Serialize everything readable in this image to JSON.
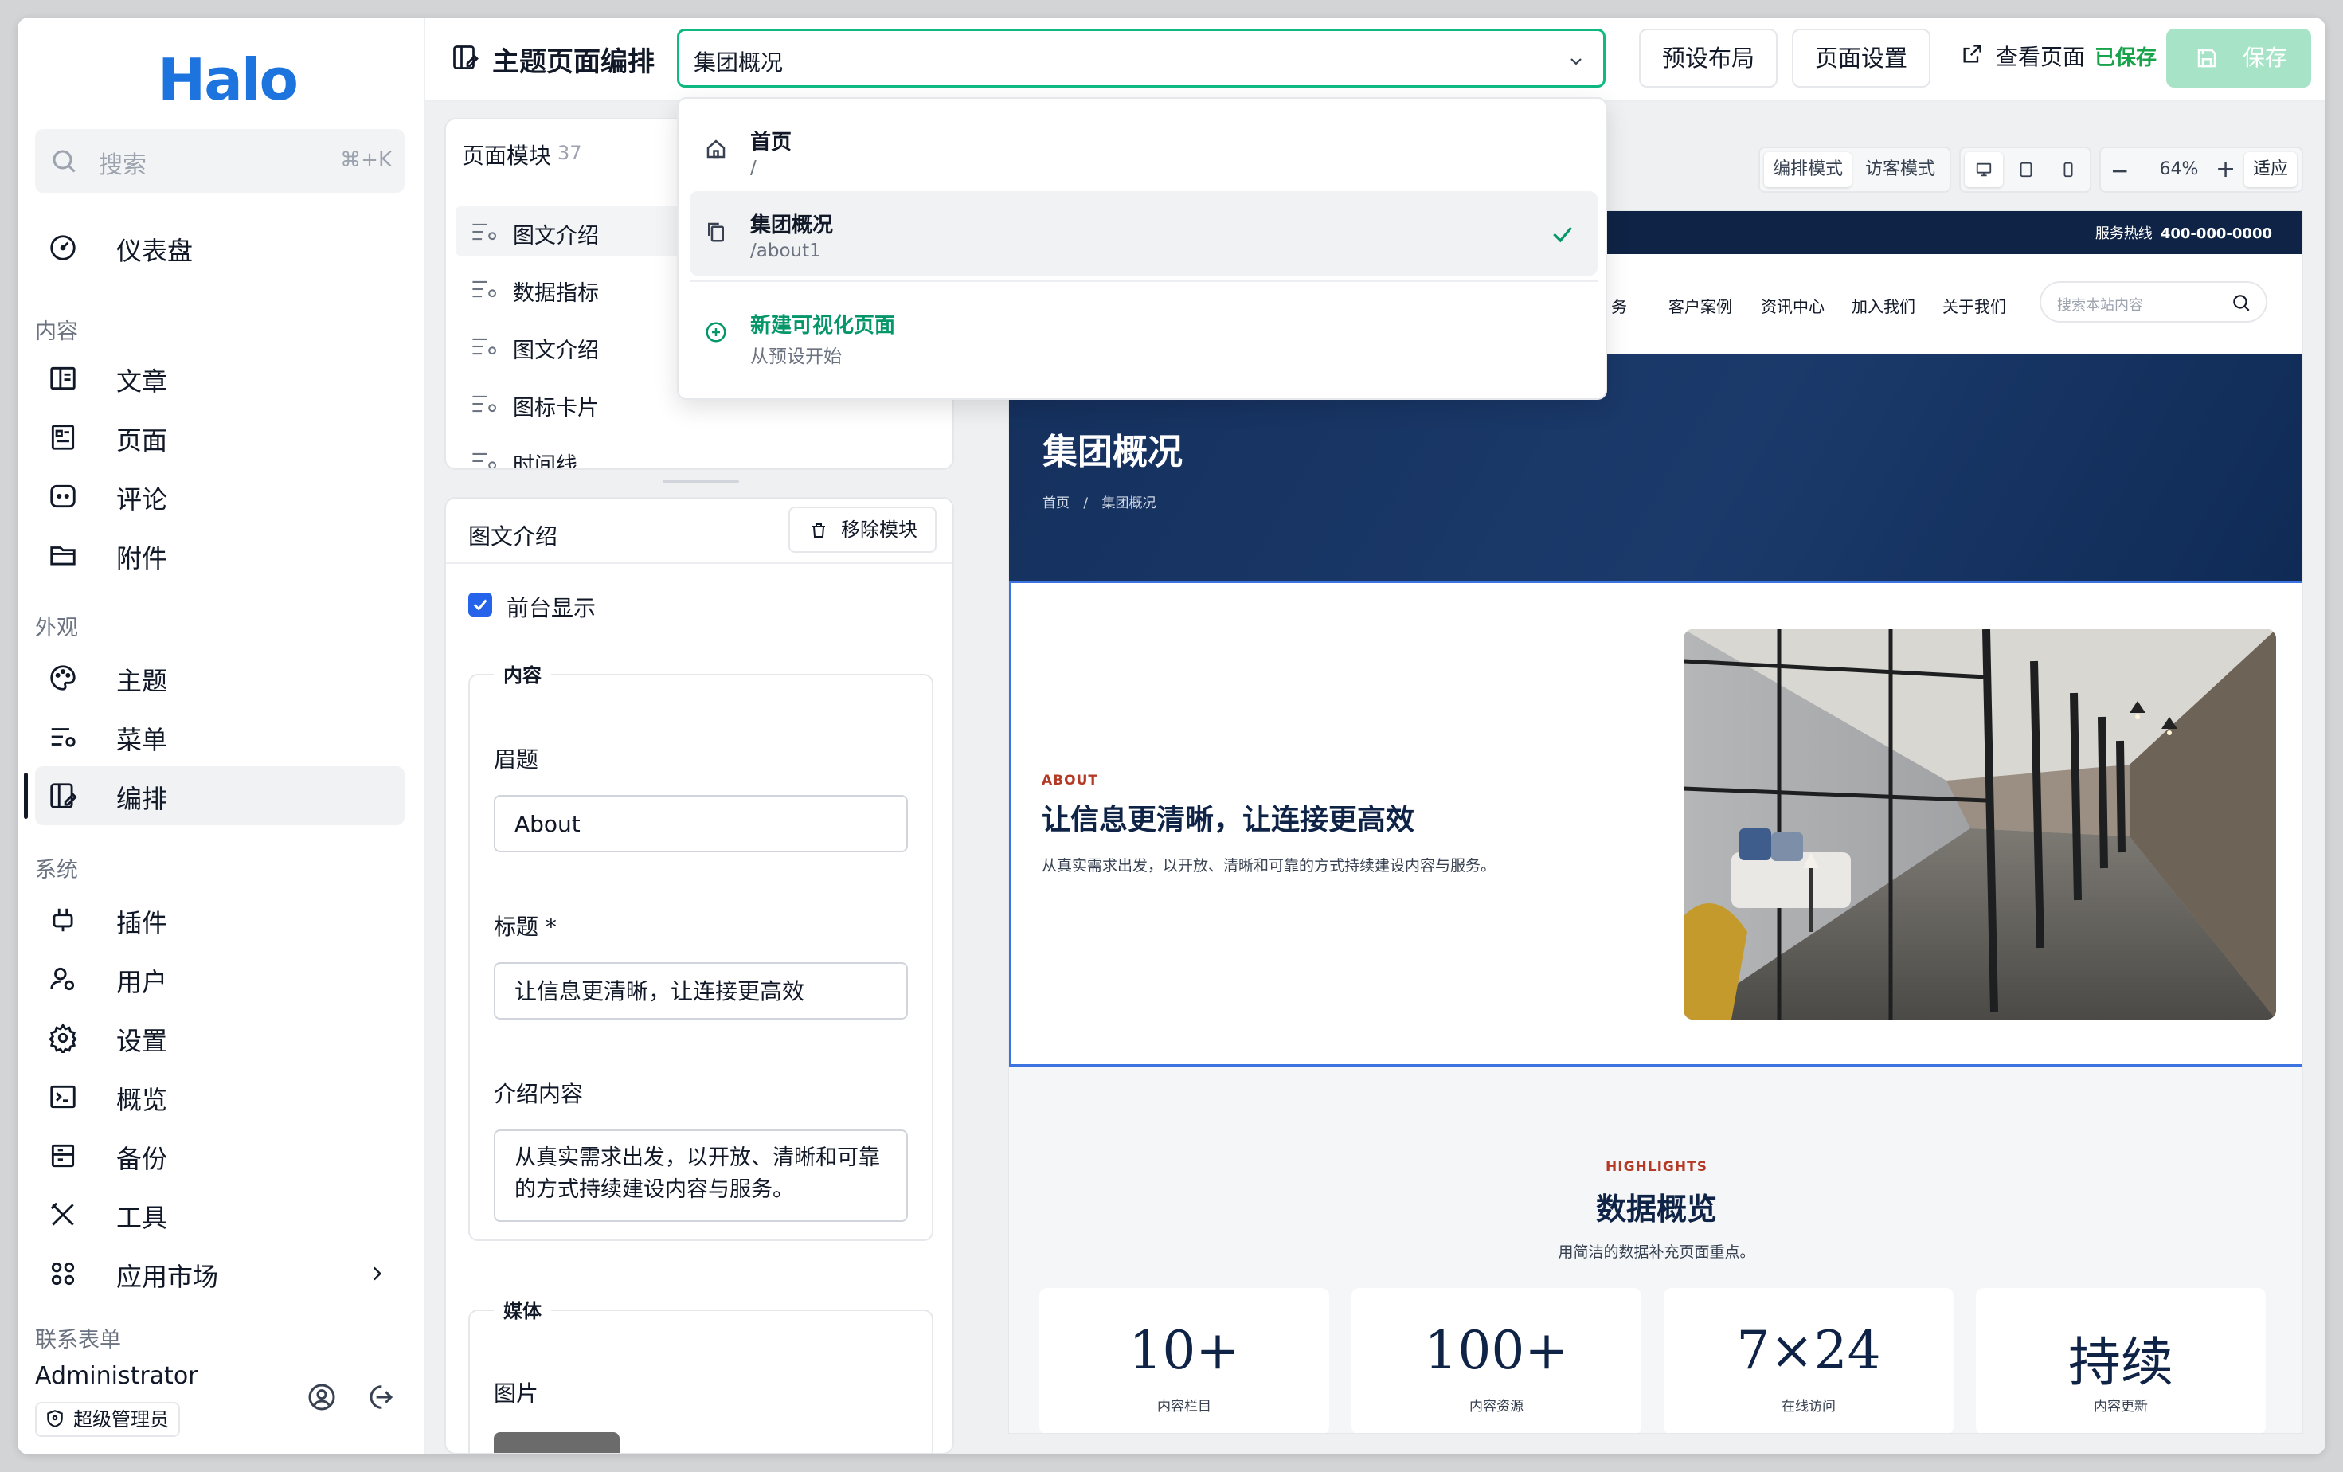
{
  "sidebar": {
    "logo": "Halo",
    "search": {
      "placeholder": "搜索",
      "shortcut": "⌘+K"
    },
    "dashboard": "仪表盘",
    "groups": {
      "content": "内容",
      "appearance": "外观",
      "system": "系统",
      "forms": "联系表单"
    },
    "content_items": [
      "文章",
      "页面",
      "评论",
      "附件"
    ],
    "appearance_items": [
      "主题",
      "菜单",
      "编排"
    ],
    "system_items": [
      "插件",
      "用户",
      "设置",
      "概览",
      "备份",
      "工具",
      "应用市场"
    ],
    "active_item": "编排",
    "user": {
      "name": "Administrator",
      "role": "超级管理员"
    }
  },
  "topbar": {
    "title": "主题页面编排",
    "page_select_value": "集团概况",
    "preset_layout": "预设布局",
    "page_settings": "页面设置",
    "view_page": "查看页面",
    "saved_status": "已保存",
    "save": "保存"
  },
  "dropdown": {
    "items": [
      {
        "label": "首页",
        "sub": "/",
        "icon": "home-icon",
        "selected": false
      },
      {
        "label": "集团概况",
        "sub": "/about1",
        "icon": "copy-icon",
        "selected": true
      }
    ],
    "new_page": {
      "label": "新建可视化页面",
      "sub": "从预设开始"
    }
  },
  "modules": {
    "title": "页面模块",
    "count": "37",
    "items": [
      "图文介绍",
      "数据指标",
      "图文介绍",
      "图标卡片",
      "时间线"
    ]
  },
  "props": {
    "title": "图文介绍",
    "remove": "移除模块",
    "show_frontend": "前台显示",
    "show_frontend_checked": true,
    "content_legend": "内容",
    "eyebrow_label": "眉题",
    "eyebrow_value": "About",
    "title_label": "标题 *",
    "title_value": "让信息更清晰，让连接更高效",
    "intro_label": "介绍内容",
    "intro_value": "从真实需求出发，以开放、清晰和可靠的方式持续建设内容与服务。",
    "media_legend": "媒体",
    "image_label": "图片"
  },
  "canvas_toolbar": {
    "edit_mode": "编排模式",
    "visitor_mode": "访客模式",
    "zoom": "64%",
    "fit": "适应",
    "devices": [
      "desktop-icon",
      "tablet-icon",
      "mobile-icon"
    ]
  },
  "preview": {
    "hotline_label": "服务热线",
    "hotline_number": "400-000-0000",
    "nav": [
      "务",
      "客户案例",
      "资讯中心",
      "加入我们",
      "关于我们"
    ],
    "search_placeholder": "搜索本站内容",
    "hero_title": "集团概况",
    "breadcrumb_home": "首页",
    "breadcrumb_sep": "/",
    "breadcrumb_current": "集团概况",
    "about": {
      "eyebrow": "ABOUT",
      "title": "让信息更清晰，让连接更高效",
      "desc": "从真实需求出发，以开放、清晰和可靠的方式持续建设内容与服务。"
    },
    "highlights": {
      "eyebrow": "HIGHLIGHTS",
      "title": "数据概览",
      "sub": "用简洁的数据补充页面重点。",
      "stats": [
        {
          "value": "10+",
          "label": "内容栏目"
        },
        {
          "value": "100+",
          "label": "内容资源"
        },
        {
          "value": "7×24",
          "label": "在线访问"
        },
        {
          "value": "持续",
          "label": "内容更新"
        }
      ]
    }
  },
  "colors": {
    "brand": "#1d74de",
    "accent_green": "#10b981",
    "navy": "#0f2346",
    "accent_red": "#b43a26",
    "check_blue": "#2563eb"
  }
}
